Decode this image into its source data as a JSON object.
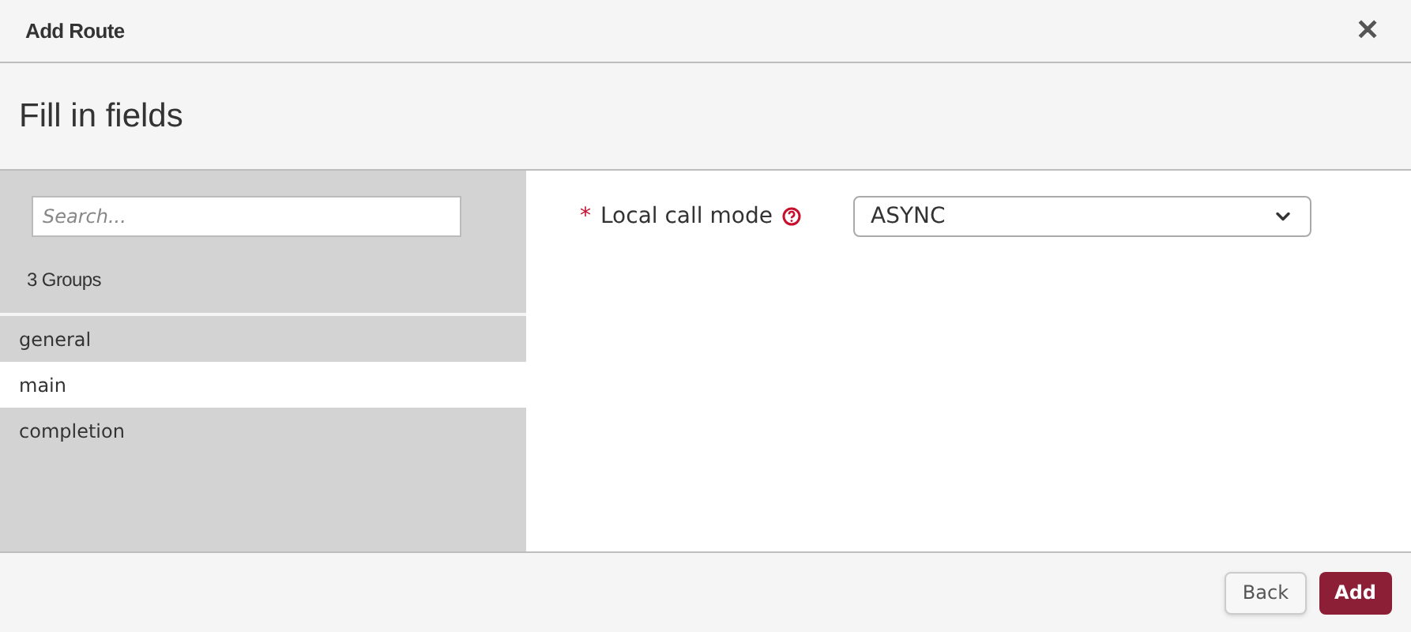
{
  "window": {
    "title": "Add Route",
    "close": "✕"
  },
  "heading": "Fill in fields",
  "sidebar": {
    "search": {
      "placeholder": "Search..."
    },
    "count": "3 Groups",
    "groups": [
      {
        "label": "general",
        "selected": false
      },
      {
        "label": "main",
        "selected": true
      },
      {
        "label": "completion",
        "selected": false
      }
    ]
  },
  "fields": [
    {
      "kind": "select",
      "label": "Local call mode",
      "required": true,
      "required_mark": "*",
      "value": "ASYNC"
    }
  ],
  "buttons": [
    {
      "label": "Back",
      "kind": "secondary"
    },
    {
      "label": "Add",
      "kind": "primary"
    }
  ]
}
